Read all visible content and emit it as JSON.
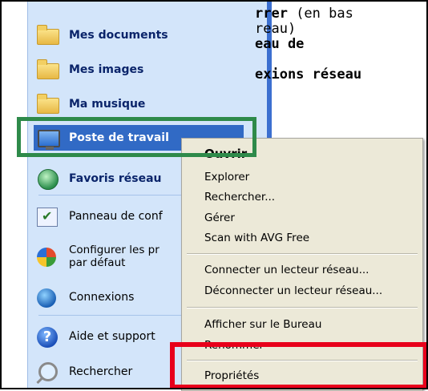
{
  "start_menu": {
    "items": [
      {
        "label": "Mes documents",
        "icon": "my-documents-icon"
      },
      {
        "label": "Mes images",
        "icon": "folder-icon"
      },
      {
        "label": "Ma musique",
        "icon": "folder-icon"
      },
      {
        "label": "Poste de travail",
        "icon": "my-computer-icon"
      },
      {
        "label": "Favoris réseau",
        "icon": "network-favorites-icon"
      },
      {
        "label": "Panneau de conf",
        "icon": "control-panel-icon"
      },
      {
        "label": "Configurer les pr",
        "label2": "par défaut",
        "icon": "default-programs-icon"
      },
      {
        "label": "Connexions",
        "icon": "connections-icon"
      },
      {
        "label": "Aide et support",
        "icon": "help-icon"
      },
      {
        "label": "Rechercher",
        "icon": "search-icon"
      }
    ]
  },
  "document_text": {
    "line1_bold": "rrer",
    "line1_rest": " (en bas",
    "line2": "reau)",
    "line3_bold": "eau de",
    "line4_bold": "exions réseau"
  },
  "context_menu": {
    "items": [
      "Ouvrir",
      "Explorer",
      "Rechercher...",
      "Gérer",
      "Scan with AVG Free",
      "Connecter un lecteur réseau...",
      "Déconnecter un lecteur réseau...",
      "Afficher sur le Bureau",
      "Renommer",
      "Propriétés"
    ]
  },
  "colors": {
    "highlight_box": "#2e8a4a",
    "properties_box": "#e8001b",
    "selection": "#316ac5"
  }
}
